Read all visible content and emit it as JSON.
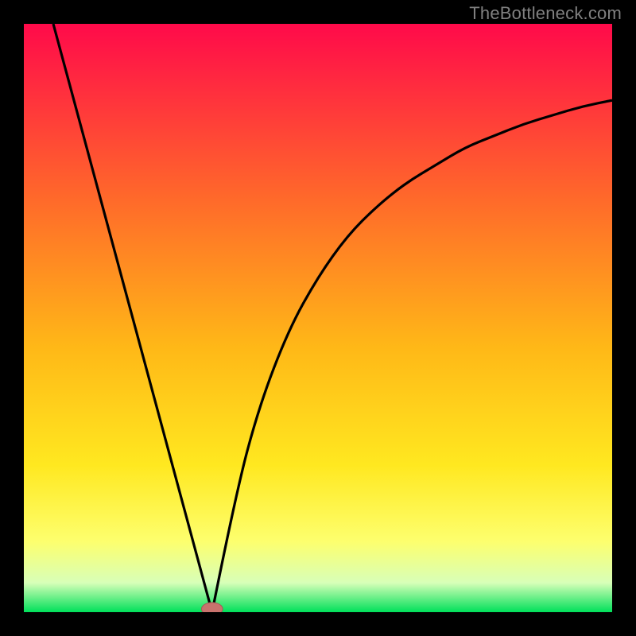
{
  "watermark": "TheBottleneck.com",
  "colors": {
    "top": "#ff0a4a",
    "mid1": "#ff6a2a",
    "mid2": "#ffb817",
    "mid3": "#ffe820",
    "mid4": "#fdff6e",
    "mid5": "#d8ffb8",
    "bottom": "#00e05a",
    "curve": "#000000",
    "marker_fill": "#c9736d",
    "marker_stroke": "#a35a55"
  },
  "chart_data": {
    "type": "line",
    "title": "",
    "xlabel": "",
    "ylabel": "",
    "xlim": [
      0,
      100
    ],
    "ylim": [
      0,
      100
    ],
    "gradient_axis": "vertical",
    "curve": {
      "minimum_x": 32,
      "minimum_y": 0,
      "left_branch": [
        {
          "x": 5,
          "y": 100
        },
        {
          "x": 32,
          "y": 0
        }
      ],
      "right_branch_samples": [
        {
          "x": 32,
          "y": 0
        },
        {
          "x": 36,
          "y": 20
        },
        {
          "x": 40,
          "y": 35
        },
        {
          "x": 45,
          "y": 48
        },
        {
          "x": 50,
          "y": 57
        },
        {
          "x": 55,
          "y": 64
        },
        {
          "x": 60,
          "y": 69
        },
        {
          "x": 65,
          "y": 73
        },
        {
          "x": 70,
          "y": 76
        },
        {
          "x": 75,
          "y": 79
        },
        {
          "x": 80,
          "y": 81
        },
        {
          "x": 85,
          "y": 83
        },
        {
          "x": 90,
          "y": 84.5
        },
        {
          "x": 95,
          "y": 86
        },
        {
          "x": 100,
          "y": 87
        }
      ]
    },
    "marker": {
      "x": 32,
      "y": 0,
      "rx": 1.8,
      "ry": 1.1
    }
  }
}
